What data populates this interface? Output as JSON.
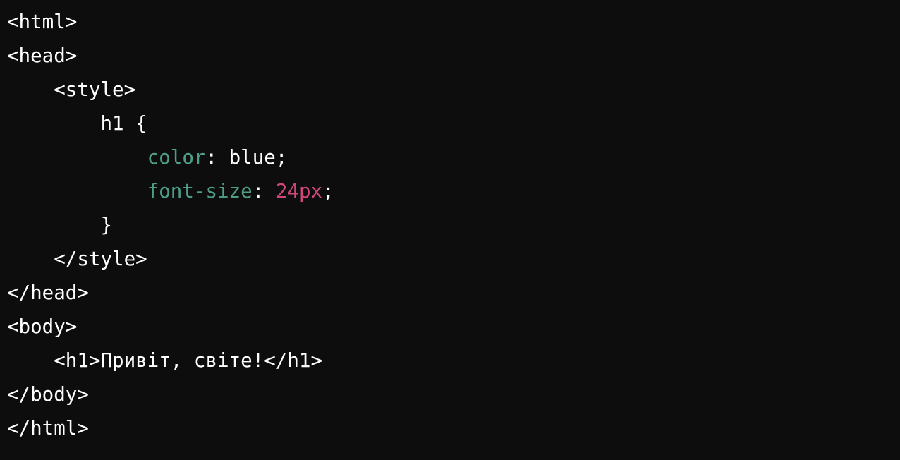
{
  "colors": {
    "background": "#0d0d0d",
    "text": "#ffffff",
    "property": "#4e9e87",
    "number": "#d0457a"
  },
  "code": {
    "line1": "<html>",
    "line2": "<head>",
    "line3": "    <style>",
    "line4": "        h1 {",
    "line5_indent": "            ",
    "line5_prop": "color",
    "line5_rest": ": blue;",
    "line6_indent": "            ",
    "line6_prop": "font-size",
    "line6_colon": ": ",
    "line6_num": "24px",
    "line6_end": ";",
    "line7": "        }",
    "line8": "    </style>",
    "line9": "</head>",
    "line10": "<body>",
    "line11": "    <h1>Привіт, світе!</h1>",
    "line12": "</body>",
    "line13": "</html>"
  }
}
